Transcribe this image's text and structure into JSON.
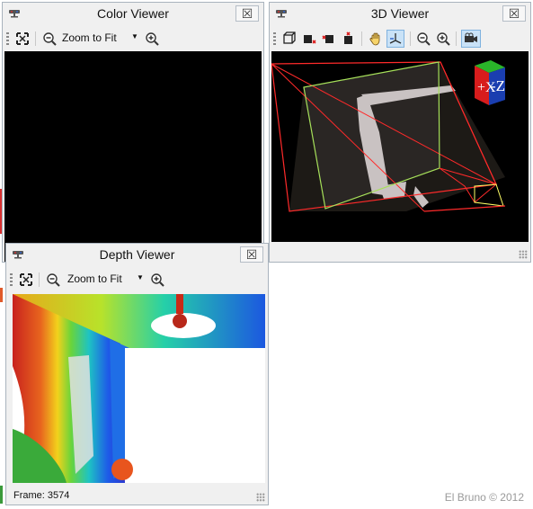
{
  "color_viewer": {
    "title": "Color Viewer",
    "close_label": "☒",
    "zoom_label": "Zoom to Fit"
  },
  "viewer_3d": {
    "title": "3D Viewer",
    "close_label": "☒",
    "cube_labels": {
      "x": "+X",
      "z": "-Z"
    }
  },
  "depth_viewer": {
    "title": "Depth Viewer",
    "close_label": "☒",
    "zoom_label": "Zoom to Fit",
    "status_text": "Frame: 3574"
  },
  "footer": {
    "watermark": "El Bruno © 2012"
  },
  "icons": [
    "kinect-icon",
    "fit-screen-icon",
    "zoom-out-icon",
    "zoom-in-icon",
    "dropdown-arrow-icon",
    "view-icon",
    "pan-hand-icon",
    "axes-icon",
    "camera-icon",
    "resize-grip-icon"
  ],
  "colors": {
    "window_bg": "#f0f0f0",
    "black_canvas": "#000000",
    "frustum_red": "#ff2020",
    "frustum_green": "#9ade4a",
    "cube_green": "#2ab52a",
    "cube_red": "#d81c1c",
    "cube_blue": "#1a3eb0"
  }
}
